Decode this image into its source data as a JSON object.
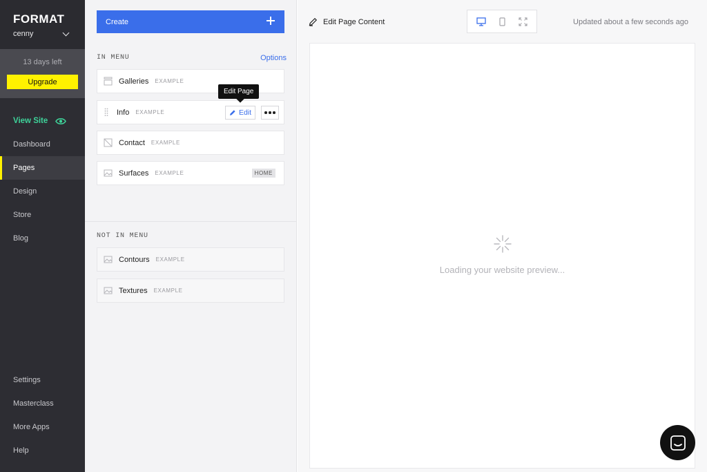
{
  "sidebar": {
    "logo": "FORMAT",
    "username": "cenny",
    "trial_text": "13 days left",
    "upgrade_label": "Upgrade",
    "nav": {
      "view_site": "View Site",
      "dashboard": "Dashboard",
      "pages": "Pages",
      "design": "Design",
      "store": "Store",
      "blog": "Blog"
    },
    "bottom": {
      "settings": "Settings",
      "masterclass": "Masterclass",
      "more_apps": "More Apps",
      "help": "Help"
    },
    "colors": {
      "accent_yellow": "#fff200",
      "view_site_green": "#3ed39a",
      "bg": "#2d2d33"
    }
  },
  "pages_panel": {
    "create_label": "Create",
    "in_menu_heading": "IN MENU",
    "options_label": "Options",
    "not_in_menu_heading": "NOT IN MENU",
    "in_menu": [
      {
        "title": "Galleries",
        "tag": "EXAMPLE",
        "icon": "gallery-icon"
      },
      {
        "title": "Info",
        "tag": "EXAMPLE",
        "icon": "drag-handle-icon"
      },
      {
        "title": "Contact",
        "tag": "EXAMPLE",
        "icon": "page-icon"
      },
      {
        "title": "Surfaces",
        "tag": "EXAMPLE",
        "icon": "image-icon",
        "badge": "HOME"
      }
    ],
    "not_in_menu": [
      {
        "title": "Contours",
        "tag": "EXAMPLE",
        "icon": "image-icon"
      },
      {
        "title": "Textures",
        "tag": "EXAMPLE",
        "icon": "image-icon"
      }
    ],
    "edit_label": "Edit",
    "tooltip": "Edit Page",
    "colors": {
      "primary_blue": "#3a6eea"
    }
  },
  "preview": {
    "edit_content_label": "Edit Page Content",
    "updated_text": "Updated about a few seconds ago",
    "loading_text": "Loading your website preview...",
    "devices": [
      "desktop-icon",
      "mobile-icon",
      "fullscreen-icon"
    ]
  }
}
